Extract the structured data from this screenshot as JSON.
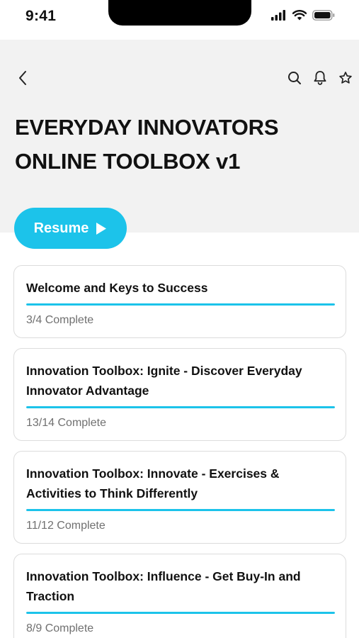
{
  "status_bar": {
    "time": "9:41"
  },
  "header": {
    "title_line1": "EVERYDAY INNOVATORS",
    "title_line2": "ONLINE TOOLBOX v1",
    "background_color": "#f2f2f2",
    "icons": [
      "back-chevron-icon",
      "search-icon",
      "bell-icon",
      "star-icon"
    ]
  },
  "resume_button": {
    "label": "Resume",
    "color": "#1cc3ea"
  },
  "modules": [
    {
      "title": "Welcome and Keys to Success",
      "status": "3/4 Complete",
      "progress": 1.0
    },
    {
      "title": "Innovation Toolbox: Ignite - Discover Everyday Innovator Advantage",
      "status": "13/14 Complete",
      "progress": 1.0
    },
    {
      "title": "Innovation Toolbox: Innovate - Exercises & Activities to Think Differently",
      "status": "11/12 Complete",
      "progress": 1.0
    },
    {
      "title": "Innovation Toolbox: Influence - Get Buy-In and Traction",
      "status": "8/9 Complete",
      "progress": 1.0
    }
  ]
}
